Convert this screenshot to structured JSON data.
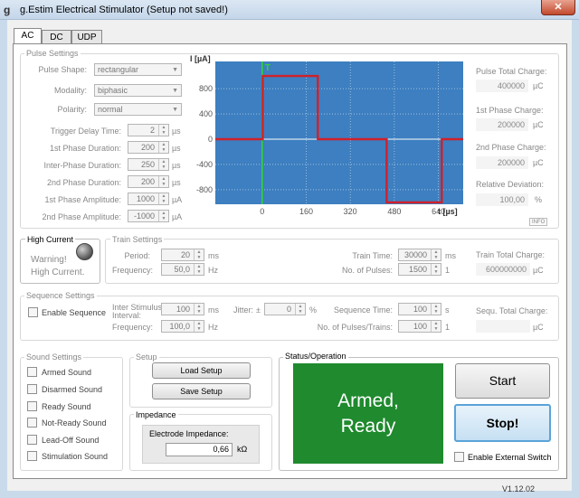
{
  "window": {
    "title": "g.Estim Electrical Stimulator  (Setup not saved!)",
    "icon_label": "g",
    "close_label": "✕"
  },
  "tabs": [
    {
      "label": "AC"
    },
    {
      "label": "DC"
    },
    {
      "label": "UDP"
    }
  ],
  "pulse_settings": {
    "title": "Pulse Settings",
    "pulse_shape": {
      "label": "Pulse Shape:",
      "value": "rectangular"
    },
    "modality": {
      "label": "Modality:",
      "value": "biphasic"
    },
    "polarity": {
      "label": "Polarity:",
      "value": "normal"
    },
    "trigger_delay": {
      "label": "Trigger Delay Time:",
      "value": "2",
      "unit": "µs"
    },
    "first_phase_duration": {
      "label": "1st Phase Duration:",
      "value": "200",
      "unit": "µs"
    },
    "inter_phase_duration": {
      "label": "Inter-Phase Duration:",
      "value": "250",
      "unit": "µs"
    },
    "second_phase_duration": {
      "label": "2nd Phase Duration:",
      "value": "200",
      "unit": "µs"
    },
    "first_phase_amplitude": {
      "label": "1st Phase Amplitude:",
      "value": "1000",
      "unit": "µA"
    },
    "second_phase_amplitude": {
      "label": "2nd Phase Amplitude:",
      "value": "-1000",
      "unit": "µA"
    }
  },
  "chart_data": {
    "type": "line",
    "ylabel": "I [µA]",
    "xlabel": "t [µs]",
    "xlim": [
      -170,
      730
    ],
    "ylim": [
      -1030,
      1230
    ],
    "x_ticks": [
      0,
      160,
      320,
      480,
      640
    ],
    "y_ticks": [
      800,
      400,
      0,
      -400,
      -800
    ],
    "x_tick_labels": [
      "0",
      "160",
      "320",
      "480",
      "640"
    ],
    "y_tick_labels": [
      "800",
      "400",
      "0",
      "-400",
      "-800"
    ],
    "grid": true,
    "background": "#3d7fc0",
    "series": [
      {
        "color": "#d1202a",
        "x": [
          -170,
          2,
          2,
          202,
          202,
          452,
          452,
          652,
          652,
          730
        ],
        "y": [
          0,
          0,
          1000,
          1000,
          0,
          0,
          -1000,
          -1000,
          0,
          0
        ]
      }
    ],
    "trigger_marker": {
      "x": 0,
      "label": "T",
      "color": "#2fd62f"
    },
    "info_badge": "INFO"
  },
  "charges": {
    "pulse_total": {
      "label": "Pulse Total Charge:",
      "value": "400000",
      "unit": "µC"
    },
    "first_phase": {
      "label": "1st Phase Charge:",
      "value": "200000",
      "unit": "µC"
    },
    "second_phase": {
      "label": "2nd Phase Charge:",
      "value": "200000",
      "unit": "µC"
    },
    "relative_deviation": {
      "label": "Relative Deviation:",
      "value": "100,00",
      "unit": "%"
    }
  },
  "high_current": {
    "title": "High Current",
    "warning_line1": "Warning!",
    "warning_line2": "High Current."
  },
  "train_settings": {
    "title": "Train Settings",
    "period": {
      "label": "Period:",
      "value": "20",
      "unit": "ms"
    },
    "frequency": {
      "label": "Frequency:",
      "value": "50,0",
      "unit": "Hz"
    },
    "train_time": {
      "label": "Train Time:",
      "value": "30000",
      "unit": "ms"
    },
    "num_pulses": {
      "label": "No. of Pulses:",
      "value": "1500",
      "unit": "1"
    },
    "total_charge": {
      "label": "Train Total Charge:",
      "value": "600000000",
      "unit": "µC"
    }
  },
  "sequence_settings": {
    "title": "Sequence Settings",
    "enable_label": "Enable Sequence",
    "isi_label_line1": "Inter Stimulus",
    "isi_label_line2": "Interval:",
    "isi": {
      "value": "100",
      "unit": "ms"
    },
    "frequency": {
      "label": "Frequency:",
      "value": "100,0",
      "unit": "Hz"
    },
    "jitter": {
      "label": "Jitter:",
      "prefix": "±",
      "value": "0",
      "unit": "%"
    },
    "sequence_time": {
      "label": "Sequence Time:",
      "value": "100",
      "unit": "s"
    },
    "num_pulses_trains": {
      "label": "No. of Pulses/Trains:",
      "value": "100",
      "unit": "1"
    },
    "total_charge": {
      "label": "Sequ. Total Charge:",
      "value": "",
      "unit": "µC"
    }
  },
  "sound_settings": {
    "title": "Sound Settings",
    "items": [
      {
        "label": "Armed Sound"
      },
      {
        "label": "Disarmed Sound"
      },
      {
        "label": "Ready Sound"
      },
      {
        "label": "Not-Ready Sound"
      },
      {
        "label": "Lead-Off Sound"
      },
      {
        "label": "Stimulation Sound"
      }
    ]
  },
  "setup": {
    "title": "Setup",
    "load_label": "Load Setup",
    "save_label": "Save Setup"
  },
  "impedance": {
    "title": "Impedance",
    "label": "Electrode Impedance:",
    "value": "0,66",
    "unit": "kΩ"
  },
  "status": {
    "title": "Status/Operation",
    "line1": "Armed,",
    "line2": "Ready",
    "color": "#1f8a2e"
  },
  "operation": {
    "start_label": "Start",
    "stop_label": "Stop!",
    "external_switch_label": "Enable External Switch"
  },
  "version": "V1.12.02"
}
